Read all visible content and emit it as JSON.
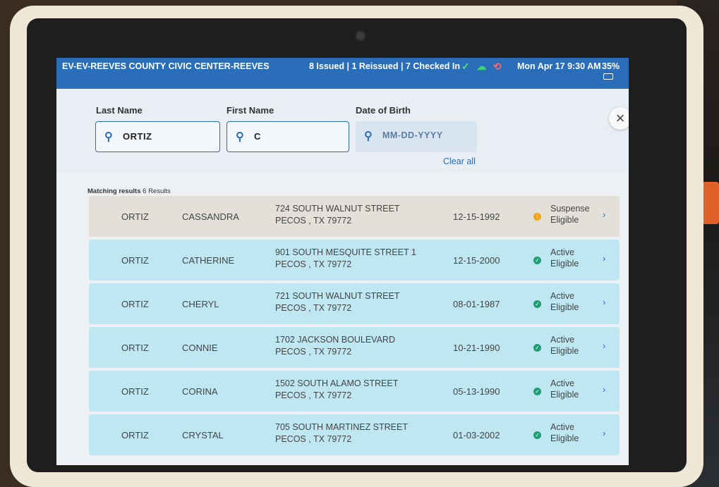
{
  "status_bar": {
    "location": "EV-EV-REEVES COUNTY CIVIC CENTER-REEVES",
    "counts": "8 Issued | 1 Reissued | 7 Checked In",
    "datetime": "Mon Apr 17  9:30 AM",
    "battery": "35%",
    "icons": [
      "check-icon",
      "cloud-icon",
      "sync-icon"
    ]
  },
  "search": {
    "last_name_label": "Last Name",
    "last_name_value": "ORTIZ",
    "first_name_label": "First Name",
    "first_name_value": "C",
    "dob_label": "Date of Birth",
    "dob_placeholder": "MM-DD-YYYY",
    "clear_all": "Clear all",
    "close": "×"
  },
  "results": {
    "label": "Matching results",
    "count_text": "6 Results",
    "rows": [
      {
        "last": "ORTIZ",
        "first": "CASSANDRA",
        "street": "724 SOUTH WALNUT STREET",
        "city": "PECOS , TX 79772",
        "dob": "12-15-1992",
        "status1": "Suspense",
        "status2": "Eligible",
        "state": "suspense"
      },
      {
        "last": "ORTIZ",
        "first": "CATHERINE",
        "street": "901 SOUTH MESQUITE STREET 1",
        "city": "PECOS , TX 79772",
        "dob": "12-15-2000",
        "status1": "Active",
        "status2": "Eligible",
        "state": "active"
      },
      {
        "last": "ORTIZ",
        "first": "CHERYL",
        "street": "721 SOUTH WALNUT STREET",
        "city": "PECOS , TX 79772",
        "dob": "08-01-1987",
        "status1": "Active",
        "status2": "Eligible",
        "state": "active"
      },
      {
        "last": "ORTIZ",
        "first": "CONNIE",
        "street": "1702 JACKSON BOULEVARD",
        "city": "PECOS , TX 79772",
        "dob": "10-21-1990",
        "status1": "Active",
        "status2": "Eligible",
        "state": "active"
      },
      {
        "last": "ORTIZ",
        "first": "CORINA",
        "street": "1502 SOUTH ALAMO STREET",
        "city": "PECOS , TX 79772",
        "dob": "05-13-1990",
        "status1": "Active",
        "status2": "Eligible",
        "state": "active"
      },
      {
        "last": "ORTIZ",
        "first": "CRYSTAL",
        "street": "705 SOUTH MARTINEZ STREET",
        "city": "PECOS , TX 79772",
        "dob": "01-03-2002",
        "status1": "Active",
        "status2": "Eligible",
        "state": "active"
      }
    ]
  },
  "colors": {
    "status_bar": "#2a6db8",
    "active_row": "#bfe7f1",
    "suspense_row": "#e2e0d8",
    "active_dot": "#1d9e74",
    "suspense_dot": "#f2a21c"
  }
}
